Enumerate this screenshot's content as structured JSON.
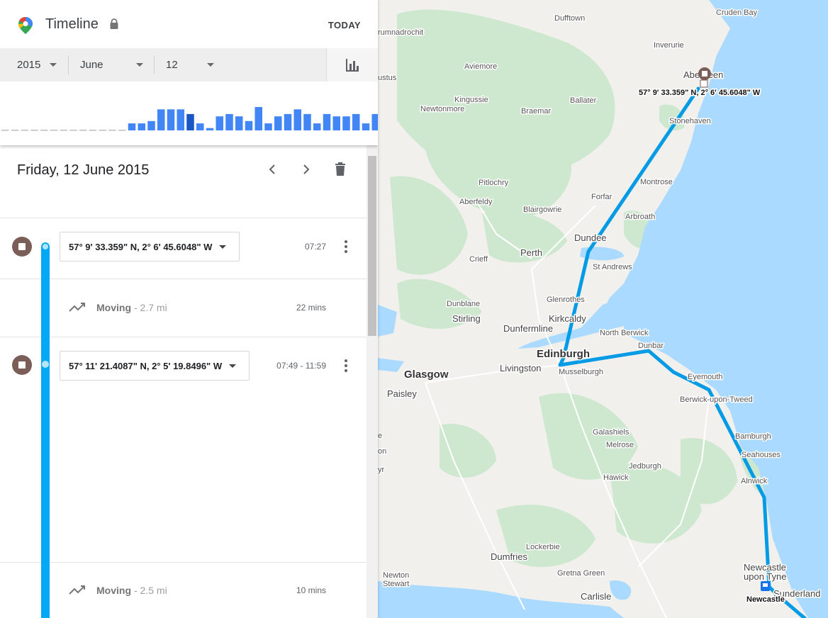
{
  "header": {
    "title": "Timeline",
    "today_label": "TODAY"
  },
  "date_selectors": {
    "year": "2015",
    "month": "June",
    "day": "12"
  },
  "histogram": {
    "colors": {
      "normal": "#4285f4",
      "selected": "#1a56c4",
      "empty": "#bdbdbd"
    },
    "values": [
      0,
      0,
      0,
      0,
      0,
      0,
      0,
      0,
      0,
      0,
      0,
      0,
      0,
      3,
      3,
      4,
      9,
      9,
      9,
      7,
      3,
      1,
      6,
      7,
      6,
      4,
      10,
      3,
      6,
      7,
      9,
      7,
      3,
      7,
      6,
      6,
      7,
      3,
      7,
      8
    ]
  },
  "day": {
    "title": "Friday, 12 June 2015"
  },
  "timeline": {
    "stops": [
      {
        "place": "57° 9' 33.359\" N, 2° 6' 45.6048\" W",
        "time": "07:27"
      },
      {
        "place": "57° 11' 21.4087\" N, 2° 5' 19.8496\" W",
        "time": "07:49 - 11:59"
      }
    ],
    "moves": [
      {
        "label": "Moving",
        "distance": "- 2.7 mi",
        "duration": "22 mins"
      },
      {
        "label": "Moving",
        "distance": "- 2.5 mi",
        "duration": "10 mins"
      }
    ],
    "line_color": "#03a9f4",
    "stop_color": "#7b5e57"
  },
  "map": {
    "marker_label": "57° 9' 33.359\" N, 2° 6' 45.6048\" W",
    "route_color": "#039be5",
    "colors": {
      "land": "#f2f0ec",
      "green": "#cde8cf",
      "water": "#aadaff"
    },
    "labels": {
      "cruden_bay": "Cruden Bay",
      "dufftown": "Dufftown",
      "drumnadrochit": "rumnadrochit",
      "inverurie": "Inverurie",
      "aviemore": "Aviemore",
      "aberdeen": "Aberdeen",
      "kingussie": "Kingussie",
      "ballater": "Ballater",
      "newtonmore": "Newtonmore",
      "braemar": "Braemar",
      "stonehaven": "Stonehaven",
      "augustus": "ustus",
      "pitlochry": "Pitlochry",
      "montrose": "Montrose",
      "forfar": "Forfar",
      "aberfeldy": "Aberfeldy",
      "blairgowrie": "Blairgowrie",
      "arbroath": "Arbroath",
      "dundee": "Dundee",
      "perth": "Perth",
      "crieff": "Crieff",
      "st_andrews": "St Andrews",
      "glenrothes": "Glenrothes",
      "dunblane": "Dunblane",
      "stirling": "Stirling",
      "kirkcaldy": "Kirkcaldy",
      "dunfermline": "Dunfermline",
      "north_berwick": "North Berwick",
      "dunbar": "Dunbar",
      "edinburgh": "Edinburgh",
      "glasgow": "Glasgow",
      "livingston": "Livingston",
      "musselburgh": "Musselburgh",
      "eyemouth": "Eyemouth",
      "paisley": "Paisley",
      "berwick": "Berwick-upon-Tweed",
      "galashiels": "Galashiels",
      "melrose": "Melrose",
      "bamburgh": "Bamburgh",
      "seahouses": "Seahouses",
      "jedburgh": "Jedburgh",
      "hawick": "Hawick",
      "alnwick": "Alnwick",
      "lockerbie": "Lockerbie",
      "dumfries": "Dumfries",
      "newcastle_1": "Newcastle",
      "newcastle_2": "upon Tyne",
      "newton_stewart_1": "Newton",
      "newton_stewart_2": "Stewart",
      "gretna_green": "Gretna Green",
      "sunderland": "Sunderland",
      "carlisle": "Carlisle",
      "newcastle_station": "Newcastle",
      "edge_1": "e",
      "edge_2": "on",
      "edge_3": "yr"
    }
  }
}
